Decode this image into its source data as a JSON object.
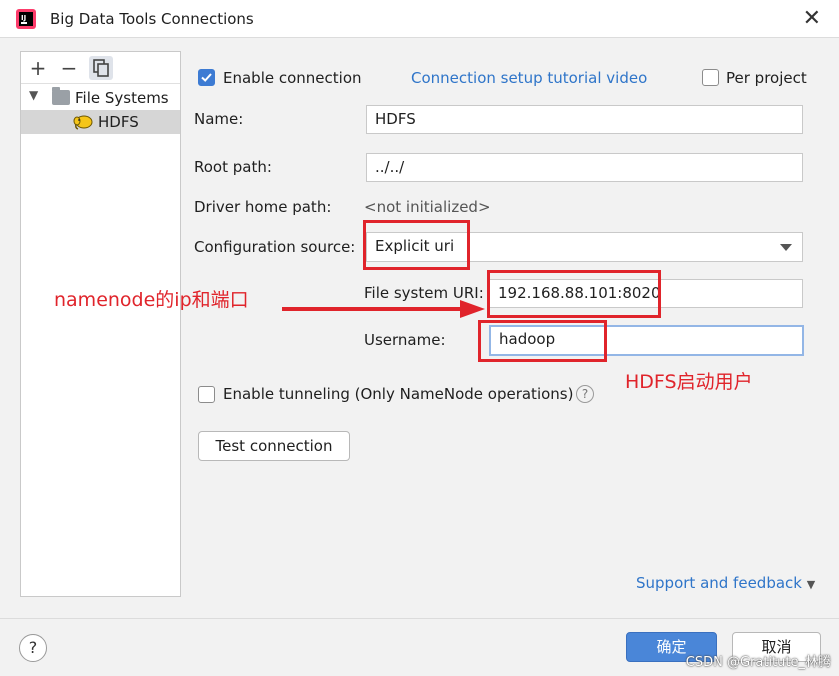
{
  "window": {
    "title": "Big Data Tools Connections"
  },
  "sidebar": {
    "toolbar": {
      "add": "+",
      "remove": "−"
    },
    "tree": [
      {
        "label": "File Systems",
        "expanded": true
      },
      {
        "label": "HDFS",
        "selected": true
      }
    ]
  },
  "form": {
    "enable_connection_label": "Enable connection",
    "enable_connection_checked": true,
    "tutorial_link": "Connection setup tutorial video",
    "per_project_label": "Per project",
    "per_project_checked": false,
    "name_label": "Name:",
    "name_value": "HDFS",
    "root_path_label": "Root path:",
    "root_path_value": "../../",
    "driver_home_label": "Driver home path:",
    "driver_home_value": "<not initialized>",
    "config_source_label": "Configuration source:",
    "config_source_value": "Explicit uri",
    "fs_uri_label": "File system URI:",
    "fs_uri_value": "192.168.88.101:8020",
    "username_label": "Username:",
    "username_value": "hadoop",
    "tunneling_label": "Enable tunneling (Only NameNode operations)",
    "tunneling_checked": false,
    "help_icon": "?",
    "test_connection_label": "Test connection",
    "support_link": "Support and feedback"
  },
  "annotations": {
    "namenode": "namenode的ip和端口",
    "hdfs_user": "HDFS启动用户",
    "color": "#e0242b"
  },
  "footer": {
    "help": "?",
    "ok_label": "确定",
    "cancel_label": "取消",
    "watermark": "CSDN @Gratitute_林腾"
  },
  "colors": {
    "accent": "#4a86d8",
    "link": "#2f75c9",
    "annotation_red": "#e0242b"
  }
}
